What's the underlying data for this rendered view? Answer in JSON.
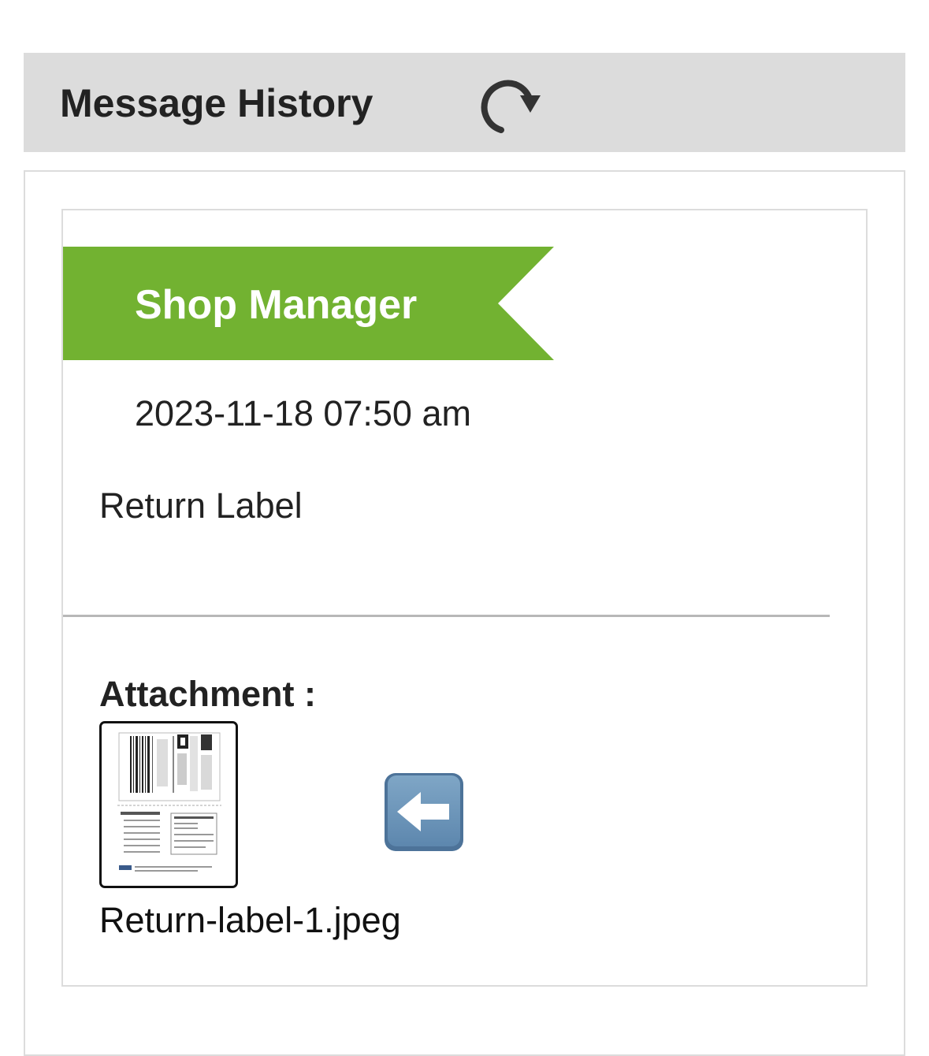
{
  "header": {
    "title": "Message History",
    "refresh_icon": "refresh-icon"
  },
  "message": {
    "sender": "Shop Manager",
    "sender_color": "#72b231",
    "timestamp": "2023-11-18 07:50 am",
    "body": "Return Label",
    "attachment": {
      "heading": "Attachment :",
      "filename": "Return-label-1.jpeg",
      "thumbnail_icon": "shipping-label-thumbnail",
      "action_icon": "left-arrow-icon"
    }
  }
}
